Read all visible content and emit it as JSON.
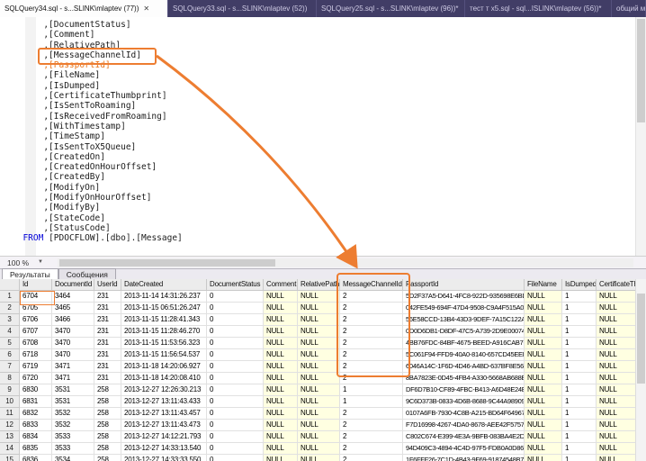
{
  "tab_bar": {
    "tabs": [
      {
        "label": "SQLQuery34.sql - s...SLINK\\mlaptev (77))",
        "active": true,
        "has_close": true
      },
      {
        "label": "SQLQuery33.sql - s...SLINK\\mlaptev (52))",
        "active": false,
        "has_close": false
      },
      {
        "label": "SQLQuery25.sql - s...SLINK\\mlaptev (96))*",
        "active": false,
        "has_close": false
      },
      {
        "label": "тест т x5.sql - sql...ISLINK\\mlaptev (56))*",
        "active": false,
        "has_close": false
      },
      {
        "label": "общий моа",
        "active": false,
        "has_close": false
      }
    ]
  },
  "editor": {
    "code_lines": [
      "      ,[DocumentStatus]",
      "      ,[Comment]",
      "      ,[RelativePath]",
      "      ,[MessageChannelId]",
      "      ,[PassportId]",
      "      ,[FileName]",
      "      ,[IsDumped]",
      "      ,[CertificateThumbprint]",
      "      ,[IsSentToRoaming]",
      "      ,[IsReceivedFromRoaming]",
      "      ,[WithTimestamp]",
      "      ,[TimeStamp]",
      "      ,[IsSentToX5Queue]",
      "      ,[CreatedOn]",
      "      ,[CreatedOnHourOffset]",
      "      ,[CreatedBy]",
      "      ,[ModifyOn]",
      "      ,[ModifyOnHourOffset]",
      "      ,[ModifyBy]",
      "      ,[StateCode]",
      "      ,[StatusCode]",
      "  FROM [PDOCFLOW].[dbo].[Message]"
    ],
    "highlighted_line": ",[MessageChannelId]",
    "orange_line": ",[PassportId]"
  },
  "status": {
    "zoom": "100 %"
  },
  "results": {
    "tabs": [
      {
        "label": "Результаты",
        "active": true
      },
      {
        "label": "Сообщения",
        "active": false
      }
    ],
    "grid": {
      "columns": [
        "Id",
        "DocumentId",
        "UserId",
        "DateCreated",
        "DocumentStatus",
        "Comment",
        "RelativePath",
        "MessageChannelId",
        "PassportId",
        "FileName",
        "IsDumped",
        "CertificateThum"
      ],
      "rows": [
        [
          "1",
          "6704",
          "3464",
          "231",
          "2013-11-14 14:31:26.237",
          "0",
          "NULL",
          "NULL",
          "2",
          "5D2F37A5-D641-4FC8-922D-935698E6BDEC",
          "NULL",
          "1",
          "NULL"
        ],
        [
          "2",
          "6705",
          "3465",
          "231",
          "2013-11-15 06:51:26.247",
          "0",
          "NULL",
          "NULL",
          "2",
          "042FE549-694F-47D4-9508-C9A4F515A042",
          "NULL",
          "1",
          "NULL"
        ],
        [
          "3",
          "6706",
          "3466",
          "231",
          "2013-11-15 11:28:41.343",
          "0",
          "NULL",
          "NULL",
          "2",
          "56E58CCD-13B4-43D3-9DEF-7A15C122A18E",
          "NULL",
          "1",
          "NULL"
        ],
        [
          "4",
          "6707",
          "3470",
          "231",
          "2013-11-15 11:28:46.270",
          "0",
          "NULL",
          "NULL",
          "2",
          "0D0D6DB1-D8DF-47C5-A739-2D9E000742DA",
          "NULL",
          "1",
          "NULL"
        ],
        [
          "5",
          "6708",
          "3470",
          "231",
          "2013-11-15 11:53:56.323",
          "0",
          "NULL",
          "NULL",
          "2",
          "4BB76FDC-84BF-4675-BEED-A916CAB764C9",
          "NULL",
          "1",
          "NULL"
        ],
        [
          "6",
          "6718",
          "3470",
          "231",
          "2013-11-15 11:56:54.537",
          "0",
          "NULL",
          "NULL",
          "2",
          "5C061F94-FFD9-40A0-8140-657CD45EEFD6",
          "NULL",
          "1",
          "NULL"
        ],
        [
          "7",
          "6719",
          "3471",
          "231",
          "2013-11-18 14:20:06.927",
          "0",
          "NULL",
          "NULL",
          "2",
          "6046A14C-1F6D-4D46-A4BD-637BF8E564E9",
          "NULL",
          "1",
          "NULL"
        ],
        [
          "8",
          "6720",
          "3471",
          "231",
          "2013-11-18 14:20:08.410",
          "0",
          "NULL",
          "NULL",
          "2",
          "8BA7823E-0D45-4FB4-A330-5668AB688E71",
          "NULL",
          "1",
          "NULL"
        ],
        [
          "9",
          "6830",
          "3531",
          "258",
          "2013-12-27 12:26:30.213",
          "0",
          "NULL",
          "NULL",
          "1",
          "DF6D7B10-CF89-4FBC-B413-A6D48E24E79B",
          "NULL",
          "1",
          "NULL"
        ],
        [
          "10",
          "6831",
          "3531",
          "258",
          "2013-12-27 13:11:43.433",
          "0",
          "NULL",
          "NULL",
          "1",
          "9C6D373B-0833-4D6B-8688-9C44A989098F",
          "NULL",
          "1",
          "NULL"
        ],
        [
          "11",
          "6832",
          "3532",
          "258",
          "2013-12-27 13:11:43.457",
          "0",
          "NULL",
          "NULL",
          "2",
          "0107A6FB-7930-4C8B-A215-BD64F64967B3",
          "NULL",
          "1",
          "NULL"
        ],
        [
          "12",
          "6833",
          "3532",
          "258",
          "2013-12-27 13:11:43.473",
          "0",
          "NULL",
          "NULL",
          "2",
          "F7D16998-4267-4DA0-8678-AEE42F575792",
          "NULL",
          "1",
          "NULL"
        ],
        [
          "13",
          "6834",
          "3533",
          "258",
          "2013-12-27 14:12:21.793",
          "0",
          "NULL",
          "NULL",
          "2",
          "C802C674-E399-4E3A-9BFB-083BA4E2D073",
          "NULL",
          "1",
          "NULL"
        ],
        [
          "14",
          "6835",
          "3533",
          "258",
          "2013-12-27 14:33:13.540",
          "0",
          "NULL",
          "NULL",
          "2",
          "94D409C3-4894-4C4D-97F5-FDB0A0D86091",
          "NULL",
          "1",
          "NULL"
        ],
        [
          "15",
          "6836",
          "3534",
          "258",
          "2013-12-27 14:33:33.550",
          "0",
          "NULL",
          "NULL",
          "2",
          "1F6FFF26-7C1D-4B43-9F69-91874548B723",
          "NULL",
          "1",
          "NULL"
        ]
      ]
    }
  },
  "annotations": {
    "color": "#ED7D31",
    "editor_box_text": ",[MessageChannelId]",
    "grid_box_column": "MessageChannelId",
    "cell_box_value": "6704"
  }
}
